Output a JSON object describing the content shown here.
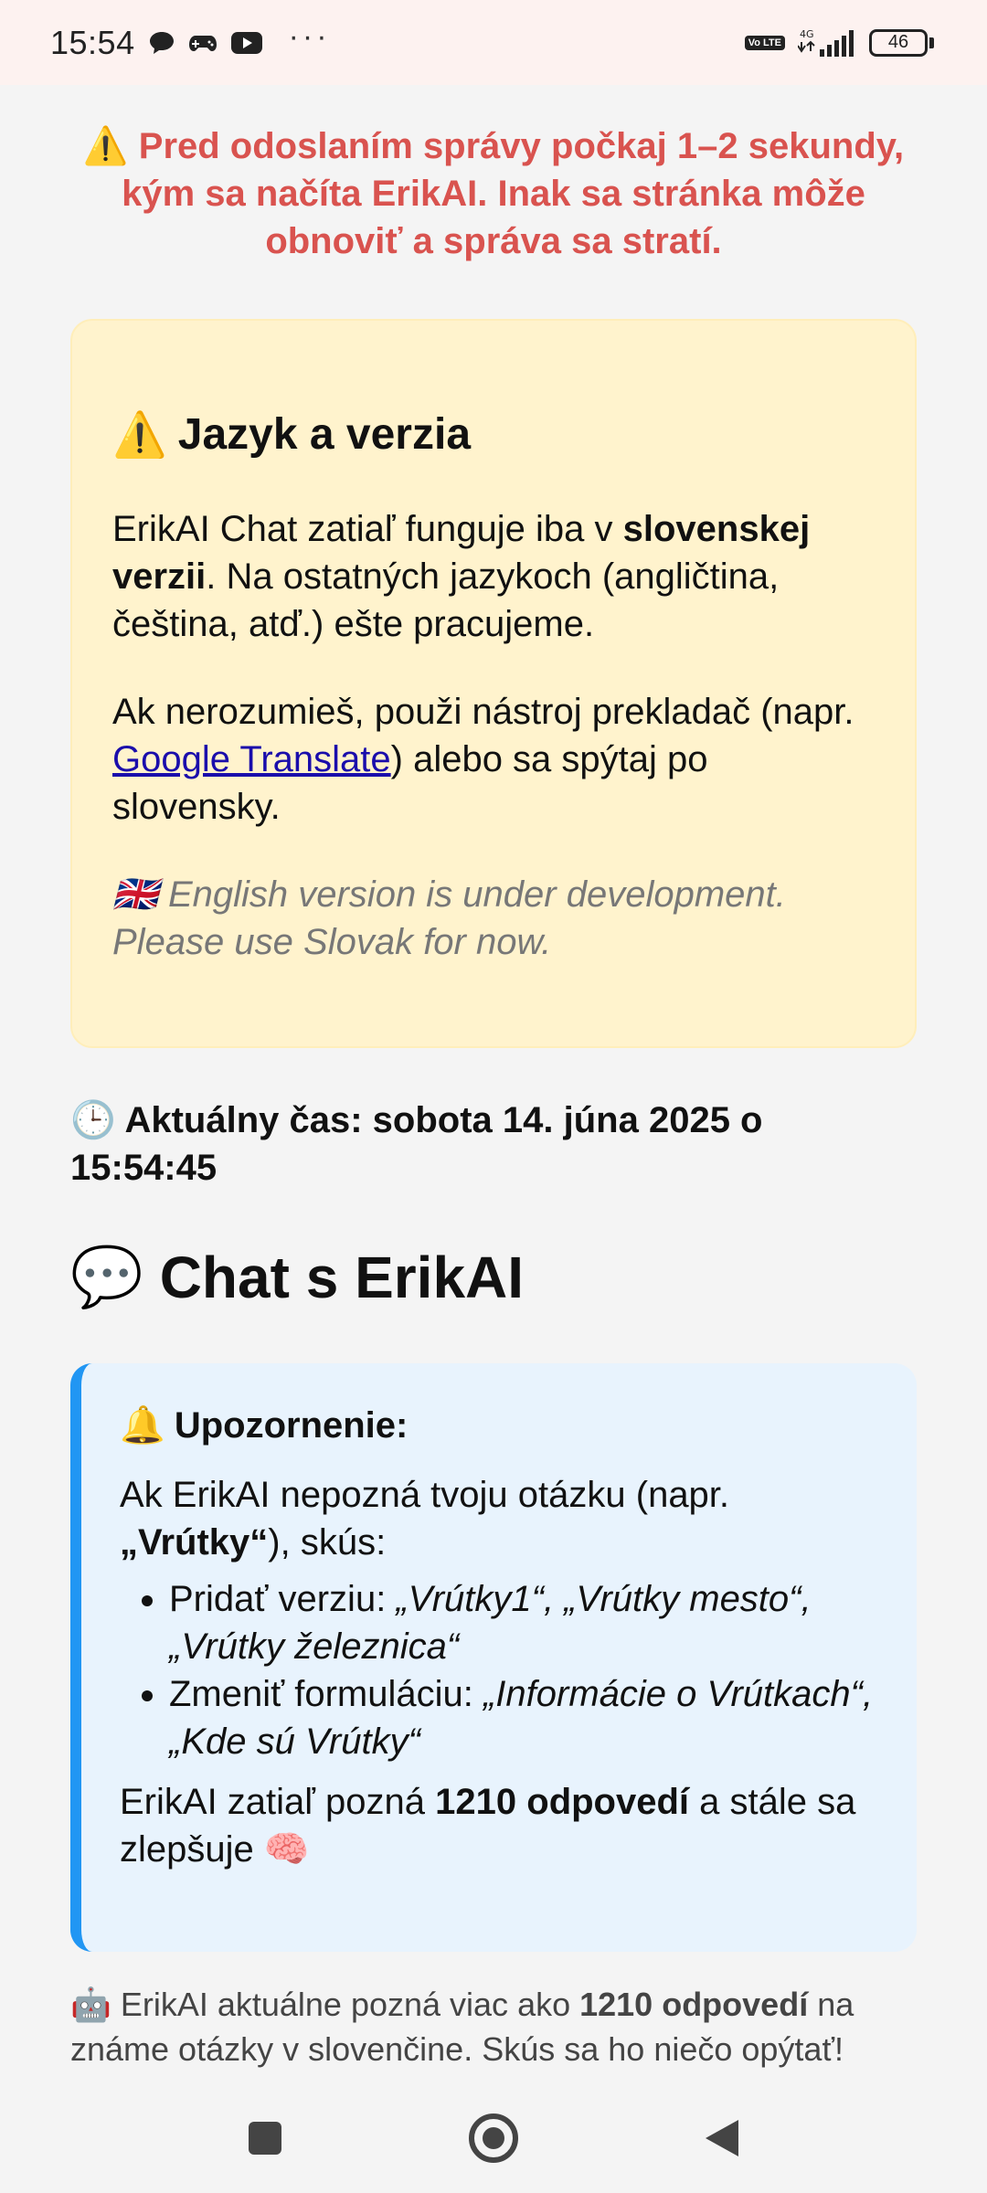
{
  "status_bar": {
    "time": "15:54",
    "icons_left": [
      "chat-bubble-icon",
      "gamepad-icon",
      "youtube-icon"
    ],
    "more": "···",
    "volte": "Vo LTE",
    "network": "4G",
    "battery": "46"
  },
  "top_warning": {
    "icon": "⚠️",
    "text": "Pred odoslaním správy počkaj 1–2 sekundy, kým sa načíta ErikAI. Inak sa stránka môže obnoviť a správa sa stratí."
  },
  "language_card": {
    "icon": "⚠️",
    "title": "Jazyk a verzia",
    "p1_before": "ErikAI Chat zatiaľ funguje iba v ",
    "p1_bold": "slovenskej verzii",
    "p1_after": ". Na ostatných jazykoch (angličtina, čeština, atď.) ešte pracujeme.",
    "p2_before": "Ak nerozumieš, použi nástroj prekladač (napr. ",
    "p2_link": "Google Translate",
    "p2_after": ") alebo sa spýtaj po slovensky.",
    "english_flag": "🇬🇧",
    "english_note": "English version is under development. Please use Slovak for now."
  },
  "current_time": {
    "icon": "🕒",
    "text": "Aktuálny čas: sobota 14. júna 2025 o 15:54:45"
  },
  "chat_heading": {
    "icon": "💬",
    "text": "Chat s ErikAI"
  },
  "notice": {
    "icon": "🔔",
    "title": "Upozornenie:",
    "intro_before": "Ak ErikAI nepozná tvoju otázku (napr. ",
    "intro_bold": "„Vrútky“",
    "intro_after": "), skús:",
    "item1_label": "Pridať verziu: ",
    "item1_examples": "„Vrútky1“, „Vrútky mesto“, „Vrútky železnica“",
    "item2_label": "Zmeniť formuláciu: ",
    "item2_examples": "„Informácie o Vrútkach“, „Kde sú Vrútky“",
    "bottom_before": "ErikAI zatiaľ pozná ",
    "bottom_bold": "1210 odpovedí",
    "bottom_after": " a stále sa zlepšuje ",
    "bottom_emoji": "🧠"
  },
  "footer": {
    "icon": "🤖",
    "before": " ErikAI aktuálne pozná viac ako ",
    "bold": "1210 odpovedí",
    "after": " na známe otázky v slovenčine. Skús sa ho niečo opýtať!"
  },
  "nav_bar": {
    "buttons": [
      "recents-square-icon",
      "home-circle-icon",
      "back-triangle-icon"
    ]
  }
}
